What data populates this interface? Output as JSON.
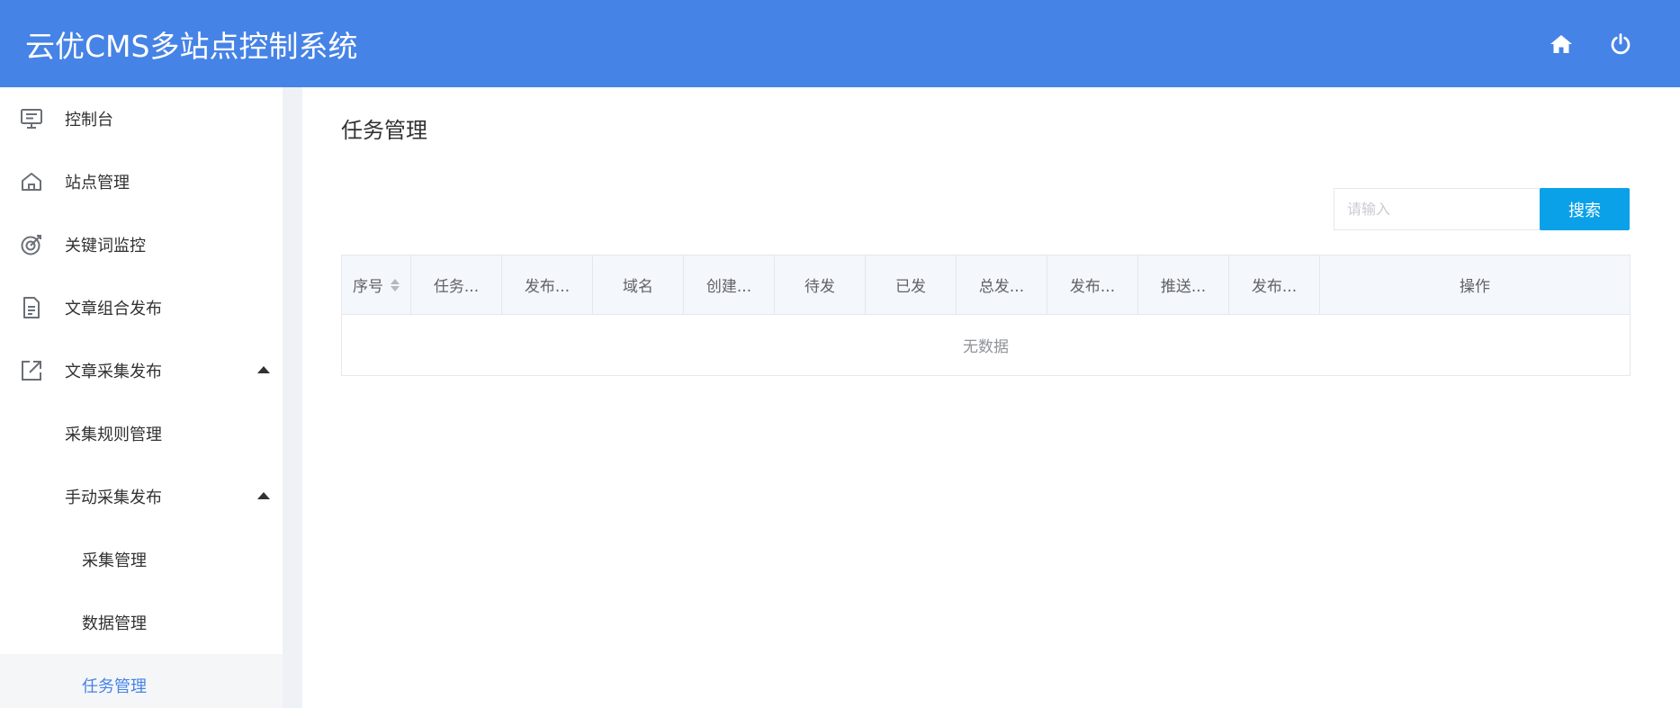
{
  "header": {
    "title": "云优CMS多站点控制系统",
    "icons": [
      "home-icon",
      "power-icon"
    ]
  },
  "sidebar": {
    "items": [
      {
        "label": "控制台",
        "icon": "monitor-icon"
      },
      {
        "label": "站点管理",
        "icon": "home-outline-icon"
      },
      {
        "label": "关键词监控",
        "icon": "target-icon"
      },
      {
        "label": "文章组合发布",
        "icon": "document-icon"
      },
      {
        "label": "文章采集发布",
        "icon": "external-link-icon",
        "expanded": true
      },
      {
        "label": "采集规则管理"
      },
      {
        "label": "手动采集发布",
        "expanded": true
      },
      {
        "label": "采集管理"
      },
      {
        "label": "数据管理"
      },
      {
        "label": "任务管理",
        "active": true
      }
    ]
  },
  "main": {
    "title": "任务管理",
    "search": {
      "placeholder": "请输入",
      "button_label": "搜索"
    },
    "table": {
      "columns": [
        "序号",
        "任务...",
        "发布...",
        "域名",
        "创建...",
        "待发",
        "已发",
        "总发...",
        "发布...",
        "推送...",
        "发布...",
        "操作"
      ],
      "empty_text": "无数据"
    }
  },
  "colors": {
    "header_bg": "#4683e6",
    "accent": "#4683e6",
    "search_button": "#0aa1e8"
  }
}
